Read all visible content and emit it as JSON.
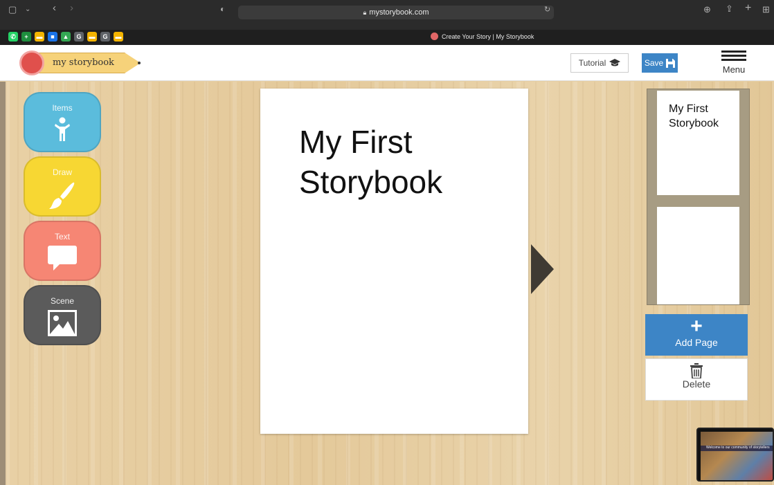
{
  "browser": {
    "url": "mystorybook.com",
    "tab_title": "Create Your Story | My Storybook",
    "favicons": [
      {
        "name": "whatsapp",
        "color": "#25d366",
        "glyph": "✆"
      },
      {
        "name": "sheets",
        "color": "#1e8e3e",
        "glyph": "+"
      },
      {
        "name": "slides",
        "color": "#f4b400",
        "glyph": "▬"
      },
      {
        "name": "meet",
        "color": "#1a73e8",
        "glyph": "■"
      },
      {
        "name": "drive",
        "color": "#34a853",
        "glyph": "▲"
      },
      {
        "name": "classroom",
        "color": "#5f6368",
        "glyph": "G"
      },
      {
        "name": "slides2",
        "color": "#f4b400",
        "glyph": "▬"
      },
      {
        "name": "classroom2",
        "color": "#5f6368",
        "glyph": "G"
      },
      {
        "name": "slides3",
        "color": "#f4b400",
        "glyph": "▬"
      }
    ]
  },
  "header": {
    "logo_text": "my storybook",
    "tutorial_label": "Tutorial",
    "save_label": "Save",
    "menu_label": "Menu"
  },
  "tools": [
    {
      "label": "Items",
      "color": "#5bbcdc",
      "icon": "person-icon"
    },
    {
      "label": "Draw",
      "color": "#f7d733",
      "icon": "brush-icon"
    },
    {
      "label": "Text",
      "color": "#f68674",
      "icon": "speech-bubble-icon"
    },
    {
      "label": "Scene",
      "color": "#5b5b5b",
      "icon": "image-icon"
    }
  ],
  "page": {
    "title": "My First Storybook"
  },
  "thumbnails": [
    {
      "title": "My First Storybook"
    },
    {
      "title": ""
    }
  ],
  "actions": {
    "add_page_label": "Add Page",
    "delete_label": "Delete"
  },
  "preview": {
    "text": "Welcome to our community of storytellers"
  }
}
